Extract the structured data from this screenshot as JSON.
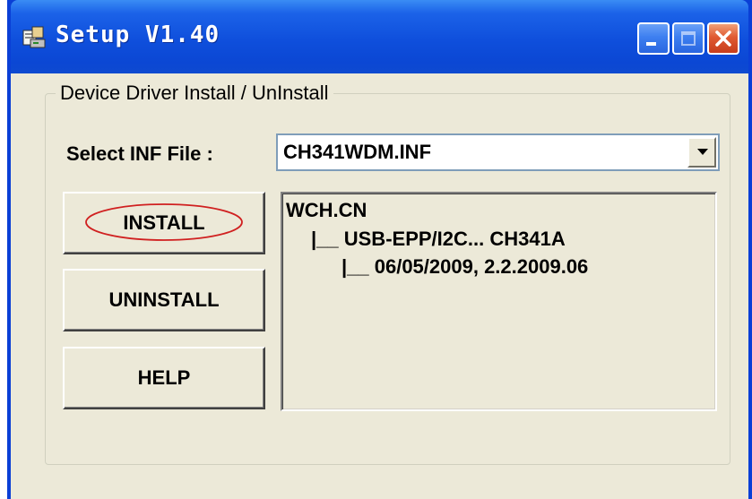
{
  "window": {
    "title": "Setup  V1.40",
    "accent_color": "#0a3fd6",
    "close_color": "#e05a32",
    "icons": {
      "app": "setup-app-icon",
      "minimize": "minimize-icon",
      "maximize": "maximize-icon",
      "close": "close-icon"
    }
  },
  "group": {
    "legend": "Device Driver Install / UnInstall"
  },
  "inf_select": {
    "label": "Select INF File :",
    "value": "CH341WDM.INF",
    "arrow_icon": "chevron-down-icon"
  },
  "buttons": {
    "install": "INSTALL",
    "uninstall": "UNINSTALL",
    "help": "HELP"
  },
  "annotation": {
    "install_highlight_color": "#d02020"
  },
  "driver_info": {
    "vendor": "WCH.CN",
    "device": "|__ USB-EPP/I2C... CH341A",
    "version": "|__ 06/05/2009, 2.2.2009.06"
  }
}
